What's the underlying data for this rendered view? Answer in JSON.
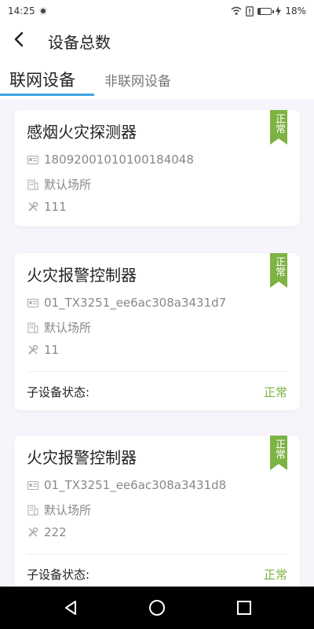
{
  "status_bar": {
    "time": "14:25",
    "battery_text": "18%"
  },
  "header": {
    "title": "设备总数"
  },
  "tabs": [
    {
      "label": "联网设备",
      "active": true
    },
    {
      "label": "非联网设备",
      "active": false
    }
  ],
  "devices": [
    {
      "name": "感烟火灾探测器",
      "status": "正常",
      "id": "18092001010100184048",
      "location": "默认场所",
      "extra": "111"
    },
    {
      "name": "火灾报警控制器",
      "status": "正常",
      "id": "01_TX3251_ee6ac308a3431d7",
      "location": "默认场所",
      "extra": "11",
      "sub_status_label": "子设备状态:",
      "sub_status_value": "正常"
    },
    {
      "name": "火灾报警控制器",
      "status": "正常",
      "id": "01_TX3251_ee6ac308a3431d8",
      "location": "默认场所",
      "extra": "222",
      "sub_status_label": "子设备状态:",
      "sub_status_value": "正常"
    }
  ],
  "colors": {
    "accent": "#3aa5e6",
    "status_green": "#7cb342",
    "list_bg": "#f8f4fb"
  },
  "icons": {
    "back": "chevron-left-icon",
    "id": "id-card-icon",
    "location": "building-icon",
    "extra": "wrench-icon"
  }
}
